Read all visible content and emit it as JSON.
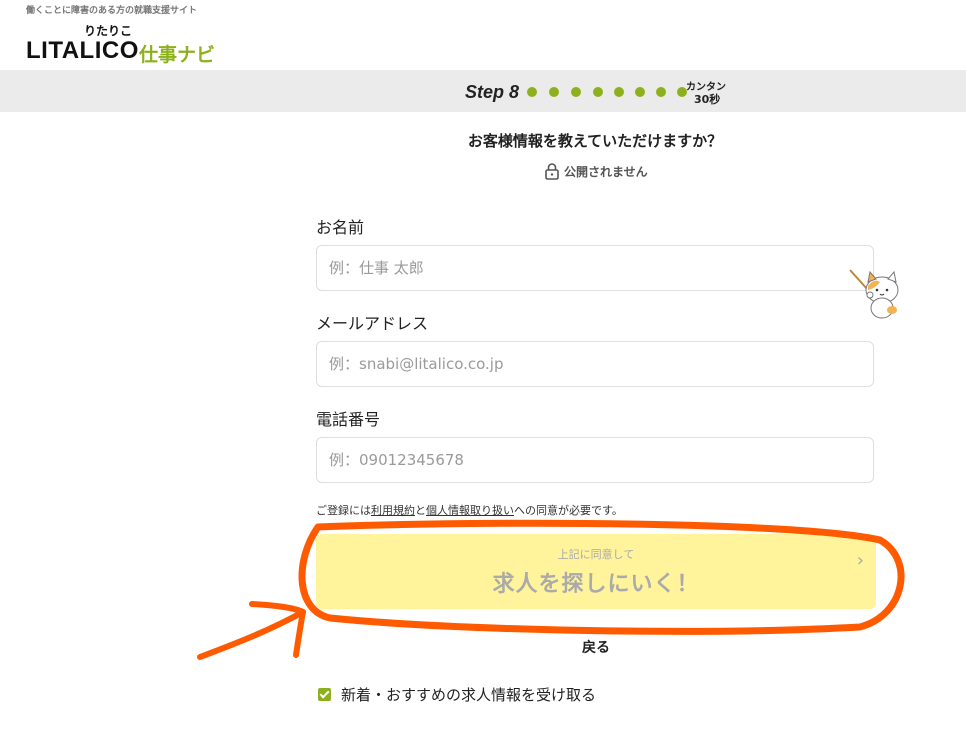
{
  "header": {
    "tagline": "働くことに障害のある方の就職支援サイト",
    "logo_ruby": "りたりこ",
    "logo_main": "LITALICO",
    "logo_sub": "仕事ナビ"
  },
  "stepbar": {
    "step_label": "Step 8",
    "dot_count": 8,
    "time_top": "カンタン",
    "time_bottom": "30秒"
  },
  "question": {
    "title": "お客様情報を教えていただけますか？",
    "privacy_note": "公開されません"
  },
  "form": {
    "name": {
      "label": "お名前",
      "placeholder": "例：仕事 太郎",
      "value": ""
    },
    "email": {
      "label": "メールアドレス",
      "placeholder": "例：snabi@litalico.co.jp",
      "value": ""
    },
    "phone": {
      "label": "電話番号",
      "placeholder": "例：09012345678",
      "value": ""
    },
    "consent": {
      "prefix": "ご登録には",
      "terms_link": "利用規約",
      "and": "と",
      "privacy_link": "個人情報取り扱い",
      "suffix": "への同意が必要です。"
    },
    "submit": {
      "sub_label": "上記に同意して",
      "main_label": "求人を探しにいく！"
    },
    "back_label": "戻る",
    "newsletter": {
      "label": "新着・おすすめの求人情報を受け取る",
      "checked": true
    }
  },
  "colors": {
    "brand_green": "#8cb11c",
    "cta_bg": "#fff39c",
    "annotation": "#ff5a00"
  }
}
